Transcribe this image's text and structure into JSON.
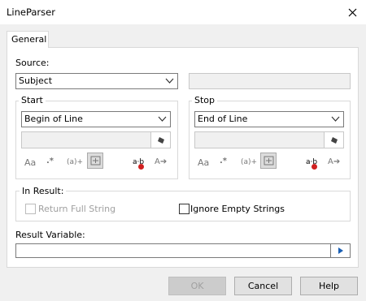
{
  "window": {
    "title": "LineParser"
  },
  "tabs": [
    {
      "label": "General"
    }
  ],
  "source": {
    "label": "Source:",
    "value": "Subject",
    "text": ""
  },
  "start": {
    "title": "Start",
    "mode": "Begin of Line",
    "text": ""
  },
  "stop": {
    "title": "Stop",
    "mode": "End of Line",
    "text": ""
  },
  "toolbar": {
    "case": "Aa",
    "regex": ".*",
    "group": "(a)+",
    "wildcard": "⬚",
    "nth": "a·b",
    "replace": "A➔"
  },
  "result": {
    "title": "In Result:",
    "return_full": "Return Full String",
    "ignore_empty": "Ignore Empty Strings",
    "return_full_checked": false,
    "ignore_empty_checked": false
  },
  "result_variable": {
    "label": "Result Variable:",
    "value": ""
  },
  "buttons": {
    "ok": "OK",
    "cancel": "Cancel",
    "help": "Help"
  }
}
